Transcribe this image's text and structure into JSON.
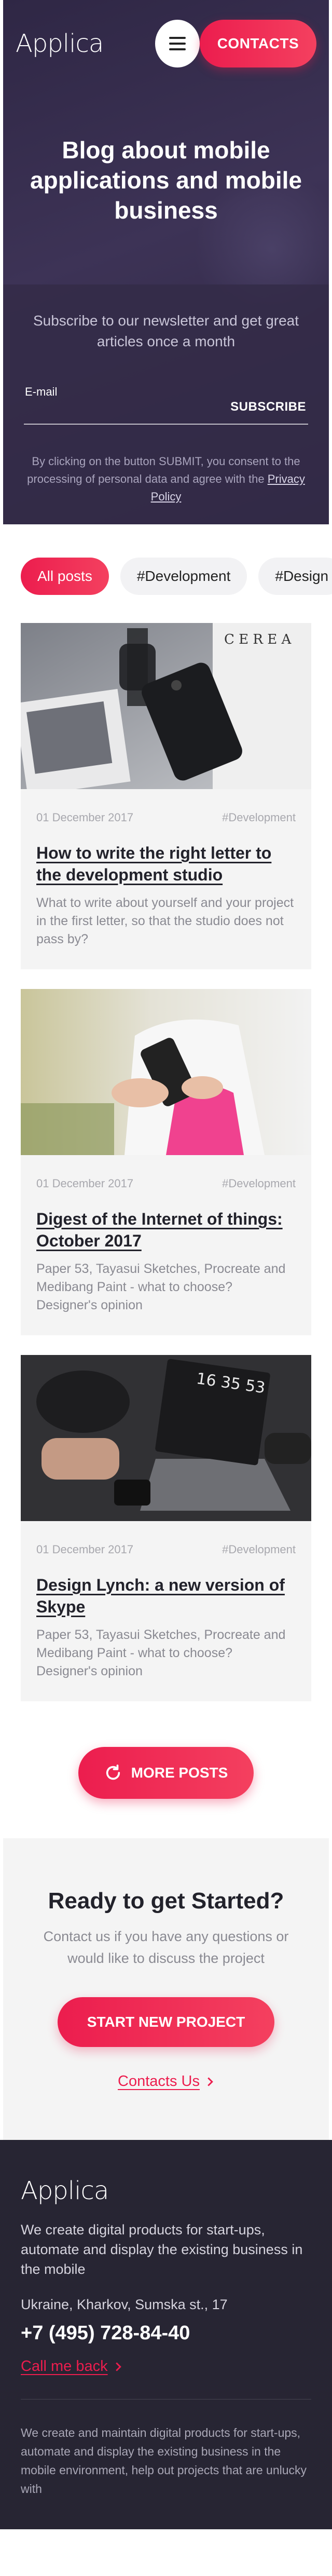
{
  "header": {
    "logo": "Applica",
    "contacts_button": "CONTACTS"
  },
  "hero": {
    "title": "Blog about mobile applications and mobile business"
  },
  "newsletter": {
    "text": "Subscribe to our newsletter and get great articles once a month",
    "email_label": "E-mail",
    "email_value": "",
    "submit_label": "SUBSCRIBE",
    "note": "By clicking on the button SUBMIT, you consent to the processing of personal data and agree with the",
    "privacy_link": "Privacy Policy"
  },
  "tags": [
    {
      "label": "All posts",
      "active": true
    },
    {
      "label": "#Development",
      "active": false
    },
    {
      "label": "#Design",
      "active": false
    }
  ],
  "posts": [
    {
      "date": "01 December 2017",
      "tag": "#Development",
      "title": "How to write the right letter to the development studio",
      "description": "What to write about yourself and your project in the first letter, so that the studio does not pass by?",
      "image_text": "C E R E A"
    },
    {
      "date": "01 December 2017",
      "tag": "#Development",
      "title": "Digest of the Internet of things: October 2017",
      "description": "Paper 53, Tayasui Sketches, Procreate and Medibang Paint - what to choose? Designer's opinion"
    },
    {
      "date": "01 December 2017",
      "tag": "#Development",
      "title": "Design Lynch: a new version of Skype",
      "description": "Paper 53, Tayasui Sketches, Procreate and Medibang Paint - what to choose? Designer's opinion",
      "image_text": "16 35 53"
    }
  ],
  "more_button": "MORE POSTS",
  "cta": {
    "title": "Ready to get Started?",
    "text": "Contact us if you have any questions or would like to discuss the project",
    "button": "START NEW PROJECT",
    "link": "Contacts Us"
  },
  "footer": {
    "logo": "Applica",
    "text": "We create digital products for start-ups, automate and display the existing business in the mobile",
    "address": "Ukraine, Kharkov, Sumska st., 17",
    "phone": "+7 (495) 728-84-40",
    "call_link": "Call me back",
    "bottom_text": "We create and maintain digital products for start-ups, automate and display the existing business in the mobile environment, help out projects that are unlucky with"
  },
  "colors": {
    "accent": "#ec1d4e",
    "hero_bg": "#2f2745",
    "footer_bg": "#272533",
    "card_bg": "#f4f4f4"
  }
}
